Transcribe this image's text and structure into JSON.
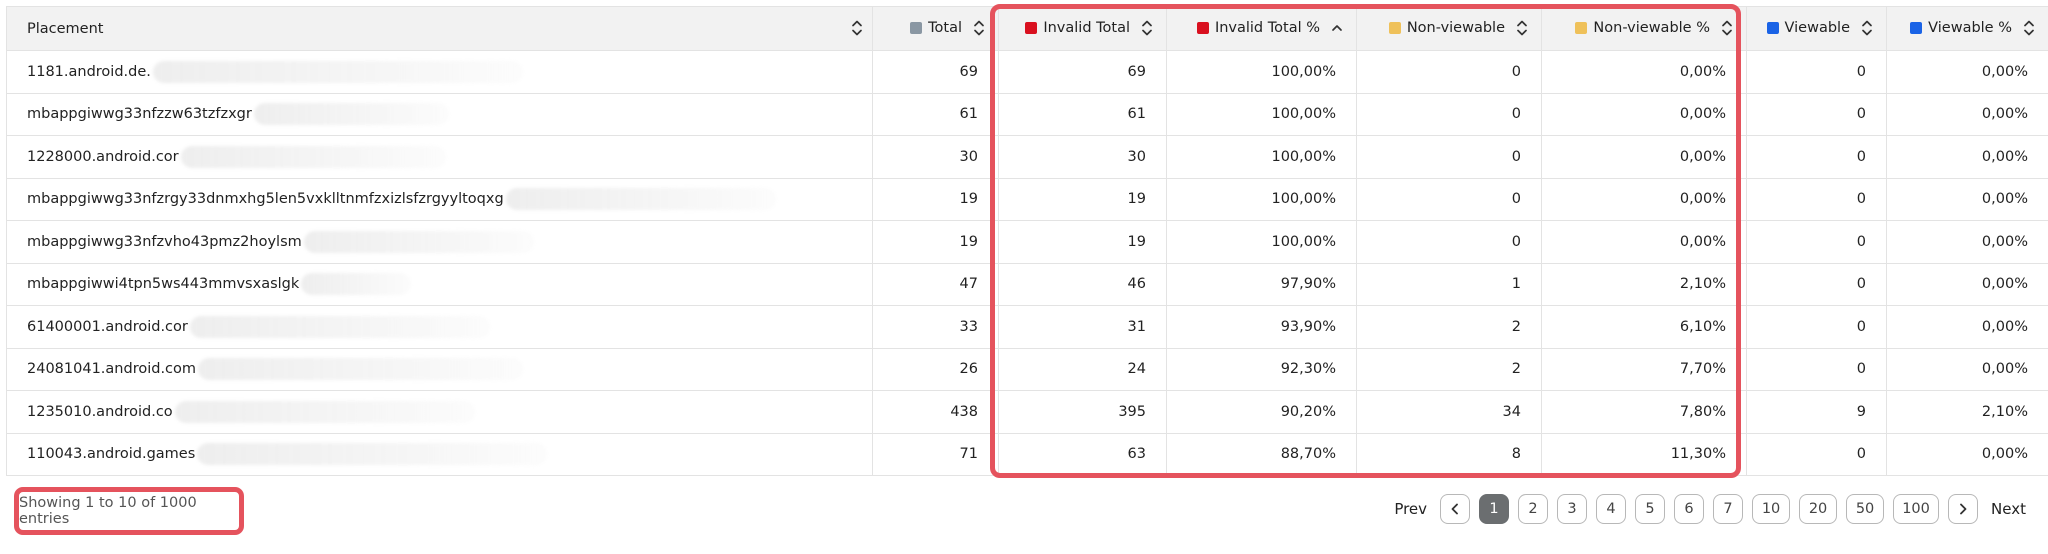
{
  "table": {
    "columns": [
      {
        "label": "Placement",
        "swatch": null,
        "sort": "both"
      },
      {
        "label": "Total",
        "swatch": "#8a97a3",
        "sort": "both"
      },
      {
        "label": "Invalid Total",
        "swatch": "#d9101f",
        "sort": "both"
      },
      {
        "label": "Invalid Total %",
        "swatch": "#d9101f",
        "sort": "asc"
      },
      {
        "label": "Non-viewable",
        "swatch": "#efc15a",
        "sort": "both"
      },
      {
        "label": "Non-viewable %",
        "swatch": "#efc15a",
        "sort": "both"
      },
      {
        "label": "Viewable",
        "swatch": "#1a63e6",
        "sort": "both"
      },
      {
        "label": "Viewable %",
        "swatch": "#1a63e6",
        "sort": "both"
      }
    ],
    "rows": [
      {
        "placement": "1181.android.de.",
        "total": "69",
        "invalid_total": "69",
        "invalid_pct": "100,00%",
        "non_viewable": "0",
        "non_viewable_pct": "0,00%",
        "viewable": "0",
        "viewable_pct": "0,00%"
      },
      {
        "placement": "mbappgiwwg33nfzzw63tzfzxgr",
        "total": "61",
        "invalid_total": "61",
        "invalid_pct": "100,00%",
        "non_viewable": "0",
        "non_viewable_pct": "0,00%",
        "viewable": "0",
        "viewable_pct": "0,00%"
      },
      {
        "placement": "1228000.android.cor",
        "total": "30",
        "invalid_total": "30",
        "invalid_pct": "100,00%",
        "non_viewable": "0",
        "non_viewable_pct": "0,00%",
        "viewable": "0",
        "viewable_pct": "0,00%"
      },
      {
        "placement": "mbappgiwwg33nfzrgy33dnmxhg5len5vxklltnmfzxizlsfzrgyyltoqxg",
        "total": "19",
        "invalid_total": "19",
        "invalid_pct": "100,00%",
        "non_viewable": "0",
        "non_viewable_pct": "0,00%",
        "viewable": "0",
        "viewable_pct": "0,00%"
      },
      {
        "placement": "mbappgiwwg33nfzvho43pmz2hoylsm",
        "total": "19",
        "invalid_total": "19",
        "invalid_pct": "100,00%",
        "non_viewable": "0",
        "non_viewable_pct": "0,00%",
        "viewable": "0",
        "viewable_pct": "0,00%"
      },
      {
        "placement": "mbappgiwwi4tpn5ws443mmvsxaslgk",
        "total": "47",
        "invalid_total": "46",
        "invalid_pct": "97,90%",
        "non_viewable": "1",
        "non_viewable_pct": "2,10%",
        "viewable": "0",
        "viewable_pct": "0,00%"
      },
      {
        "placement": "61400001.android.cor",
        "total": "33",
        "invalid_total": "31",
        "invalid_pct": "93,90%",
        "non_viewable": "2",
        "non_viewable_pct": "6,10%",
        "viewable": "0",
        "viewable_pct": "0,00%"
      },
      {
        "placement": "24081041.android.com",
        "total": "26",
        "invalid_total": "24",
        "invalid_pct": "92,30%",
        "non_viewable": "2",
        "non_viewable_pct": "7,70%",
        "viewable": "0",
        "viewable_pct": "0,00%"
      },
      {
        "placement": "1235010.android.co",
        "total": "438",
        "invalid_total": "395",
        "invalid_pct": "90,20%",
        "non_viewable": "34",
        "non_viewable_pct": "7,80%",
        "viewable": "9",
        "viewable_pct": "2,10%"
      },
      {
        "placement": "110043.android.games",
        "total": "71",
        "invalid_total": "63",
        "invalid_pct": "88,70%",
        "non_viewable": "8",
        "non_viewable_pct": "11,30%",
        "viewable": "0",
        "viewable_pct": "0,00%"
      }
    ]
  },
  "footer": {
    "entries_info": "Showing 1 to 10 of 1000 entries"
  },
  "pagination": {
    "prev_label": "Prev",
    "next_label": "Next",
    "pages": [
      "1",
      "2",
      "3",
      "4",
      "5",
      "6",
      "7",
      "10",
      "20",
      "50",
      "100"
    ],
    "active_page": "1"
  }
}
